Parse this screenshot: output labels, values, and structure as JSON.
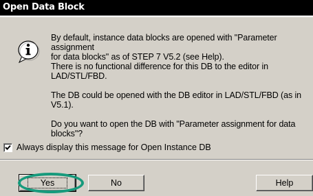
{
  "window": {
    "title": "Open Data Block"
  },
  "message": {
    "paragraph1": "By default, instance data blocks are opened with \"Parameter assignment\nfor data blocks\" as of STEP 7 V5.2 (see Help).\nThere is no functional difference for this DB to the editor in\nLAD/STL/FBD.",
    "paragraph2": "The DB could be opened with the DB editor in LAD/STL/FBD (as in\nV5.1).",
    "paragraph3": "Do you want to open the DB with \"Parameter assignment for data\nblocks\"?",
    "icon": "info-icon"
  },
  "checkbox": {
    "label": "Always display this message for Open Instance DB",
    "checked": true
  },
  "buttons": {
    "yes": "Yes",
    "no": "No",
    "help": "Help"
  },
  "colors": {
    "titlebar": "#000000",
    "dialog_bg": "#d4d0c8",
    "highlight_ring": "#169a7c"
  }
}
